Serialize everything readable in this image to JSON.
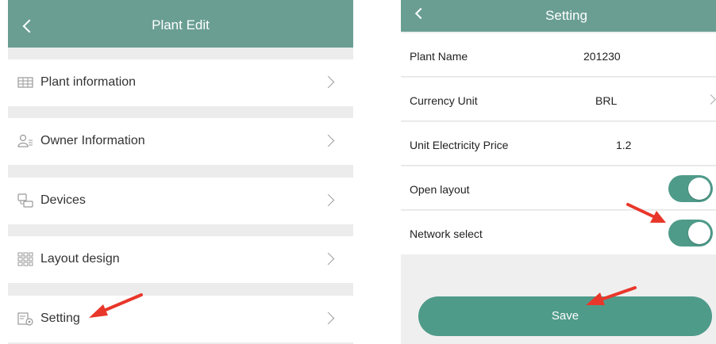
{
  "left_screen": {
    "title": "Plant Edit",
    "items": [
      {
        "label": "Plant information",
        "icon": "plant-info-icon"
      },
      {
        "label": "Owner Information",
        "icon": "owner-icon"
      },
      {
        "label": "Devices",
        "icon": "devices-icon"
      },
      {
        "label": "Layout design",
        "icon": "layout-grid-icon"
      },
      {
        "label": "Setting",
        "icon": "setting-icon"
      }
    ]
  },
  "right_screen": {
    "title": "Setting",
    "rows": [
      {
        "label": "Plant Name",
        "value": "201230"
      },
      {
        "label": "Currency Unit",
        "value": "BRL"
      },
      {
        "label": "Unit Electricity Price",
        "value": "1.2"
      }
    ],
    "toggles": [
      {
        "label": "Open layout",
        "on": true
      },
      {
        "label": "Network select",
        "on": true
      }
    ],
    "save_label": "Save"
  },
  "colors": {
    "header": "#6a9e93",
    "accent": "#4f9b8a",
    "arrow": "#e8372a"
  }
}
